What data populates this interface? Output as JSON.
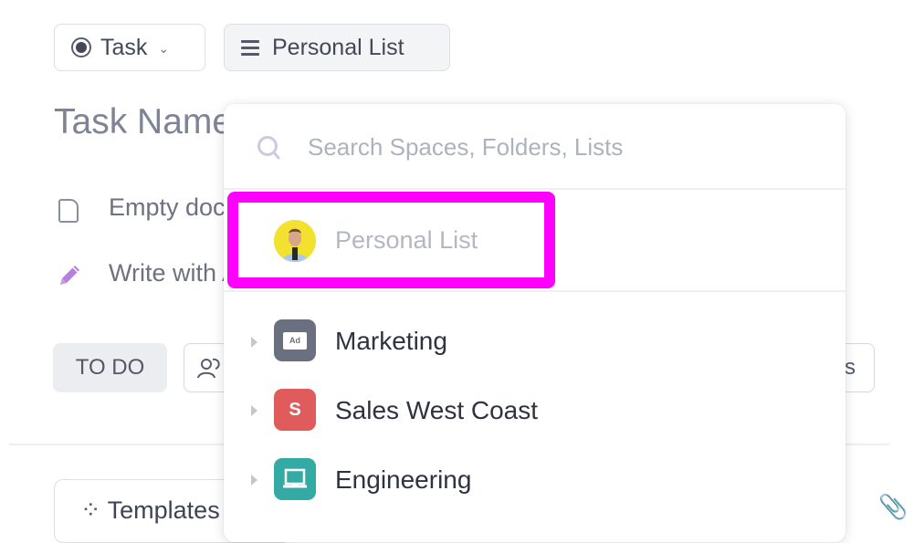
{
  "toolbar": {
    "task_type_label": "Task",
    "task_type_chevron": "⌄",
    "list_label": "Personal List"
  },
  "task": {
    "name_placeholder": "Task Name",
    "description_option": "Empty doc",
    "ai_option": "Write with AI",
    "status": "TO DO",
    "right_button_partial": "s",
    "templates_label": "Templates"
  },
  "dropdown": {
    "search_placeholder": "Search Spaces, Folders, Lists",
    "current": {
      "label": "Personal List",
      "icon": "user-avatar"
    },
    "spaces": [
      {
        "label": "Marketing",
        "icon": "ad-icon",
        "color": "#6b7080",
        "glyph": "Ad"
      },
      {
        "label": "Sales West Coast",
        "icon": "letter-avatar",
        "color": "#e05c5c",
        "glyph": "S"
      },
      {
        "label": "Engineering",
        "icon": "laptop-icon",
        "color": "#34aaa5",
        "glyph": ""
      }
    ]
  },
  "colors": {
    "highlight": "#ff00ff",
    "ai_pencil": "#b77fe0"
  }
}
